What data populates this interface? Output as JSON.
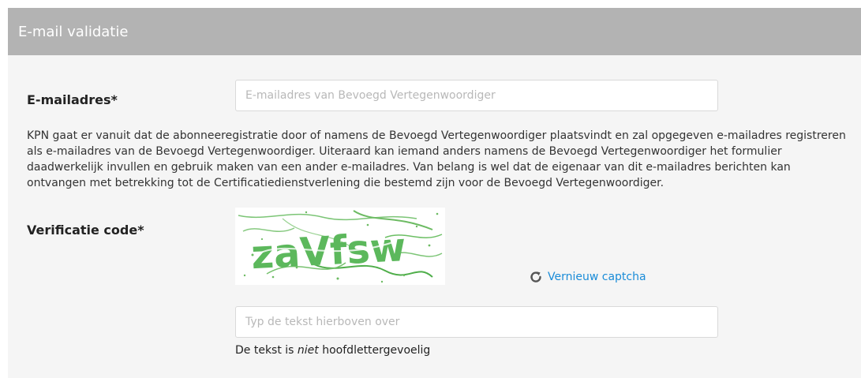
{
  "section": {
    "title": "E-mail validatie"
  },
  "email": {
    "label": "E-mailadres*",
    "placeholder": "E-mailadres van Bevoegd Vertegenwoordiger",
    "value": ""
  },
  "description": "KPN gaat er vanuit dat de abonneeregistratie door of namens de Bevoegd Vertegenwoordiger plaatsvindt en zal opgegeven e-mailadres registreren als e-mailadres van de Bevoegd Vertegenwoordiger. Uiteraard kan iemand anders namens de Bevoegd Vertegenwoordiger het formulier daadwerkelijk invullen en gebruik maken van een ander e-mailadres. Van belang is wel dat de eigenaar van dit e-mailadres berichten kan ontvangen met betrekking tot de Certificatiedienstverlening die bestemd zijn voor de Bevoegd Vertegenwoordiger.",
  "verification": {
    "label": "Verificatie code*",
    "captcha_text": "zaVfsw",
    "refresh_icon": "refresh-icon",
    "refresh_label": "Vernieuw captcha",
    "input_placeholder": "Typ de tekst hierboven over",
    "input_value": "",
    "hint_before": "De tekst is ",
    "hint_emphasis": "niet",
    "hint_after": " hoofdlettergevoelig"
  },
  "colors": {
    "header_bg": "#b3b3b3",
    "panel_bg": "#f5f5f5",
    "link": "#1a8cd8",
    "captcha_green": "#5cb85c"
  }
}
